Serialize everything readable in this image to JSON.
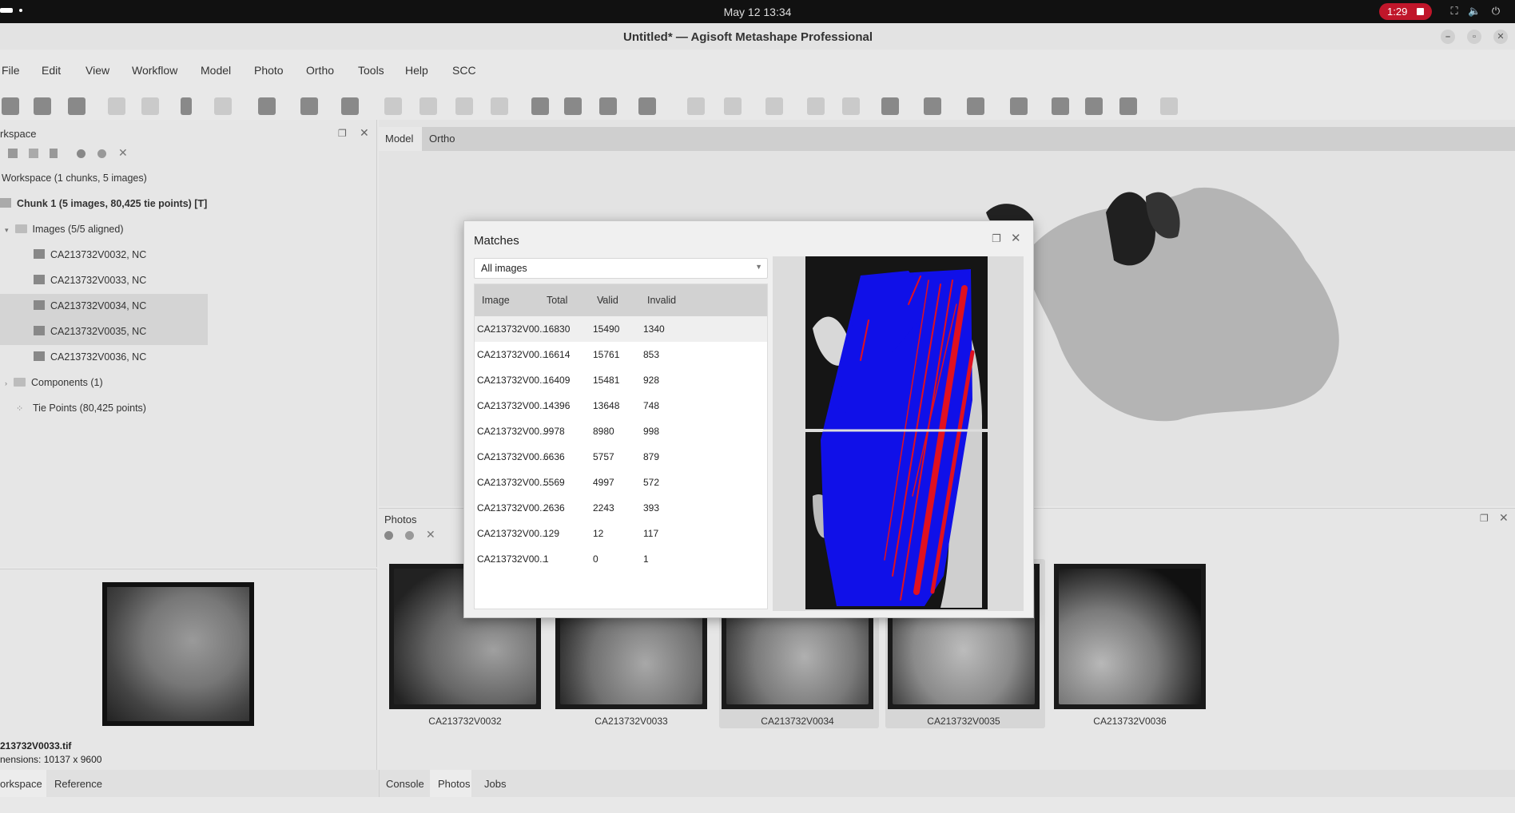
{
  "topbar": {
    "clock": "May 12  13:34",
    "record_time": "1:29"
  },
  "window": {
    "title": "Untitled* — Agisoft Metashape Professional"
  },
  "menu": [
    "File",
    "Edit",
    "View",
    "Workflow",
    "Model",
    "Photo",
    "Ortho",
    "Tools",
    "Help",
    "SCC"
  ],
  "workspace": {
    "pane_title": "rkspace",
    "root": "Workspace (1 chunks, 5 images)",
    "chunk": "Chunk 1 (5 images, 80,425 tie points) [T]",
    "images_folder": "Images (5/5 aligned)",
    "images": [
      "CA213732V0032, NC",
      "CA213732V0033, NC",
      "CA213732V0034, NC",
      "CA213732V0035, NC",
      "CA213732V0036, NC"
    ],
    "components": "Components (1)",
    "tie_points": "Tie Points (80,425 points)"
  },
  "preview": {
    "filename": "213732V0033.tif",
    "dimensions": "nensions: 10137 x 9600"
  },
  "view_tabs": [
    "Model",
    "Ortho"
  ],
  "photos_pane": {
    "title": "Photos",
    "thumbs": [
      "CA213732V0032",
      "CA213732V0033",
      "CA213732V0034",
      "CA213732V0035",
      "CA213732V0036"
    ]
  },
  "bottom_tabs_left": [
    "orkspace",
    "Reference"
  ],
  "bottom_tabs_right": [
    "Console",
    "Photos",
    "Jobs"
  ],
  "dialog": {
    "title": "Matches",
    "filter": "All images",
    "columns": [
      "Image",
      "Total",
      "Valid",
      "Invalid"
    ],
    "rows": [
      [
        "CA213732V00...",
        "16830",
        "15490",
        "1340"
      ],
      [
        "CA213732V00...",
        "16614",
        "15761",
        "853"
      ],
      [
        "CA213732V00...",
        "16409",
        "15481",
        "928"
      ],
      [
        "CA213732V00...",
        "14396",
        "13648",
        "748"
      ],
      [
        "CA213732V00...",
        "9978",
        "8980",
        "998"
      ],
      [
        "CA213732V00...",
        "6636",
        "5757",
        "879"
      ],
      [
        "CA213732V00...",
        "5569",
        "4997",
        "572"
      ],
      [
        "CA213732V00...",
        "2636",
        "2243",
        "393"
      ],
      [
        "CA213732V00...",
        "129",
        "12",
        "117"
      ],
      [
        "CA213732V00...",
        "1",
        "0",
        "1"
      ]
    ]
  },
  "colors": {
    "match_valid": "#1010e8",
    "match_invalid": "#e01020",
    "record": "#c0162a"
  }
}
